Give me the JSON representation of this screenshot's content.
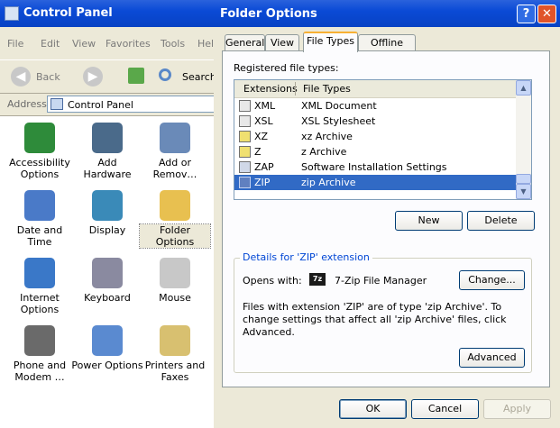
{
  "control_panel": {
    "title": "Control Panel",
    "menu": [
      "File",
      "Edit",
      "View",
      "Favorites",
      "Tools",
      "Hel"
    ],
    "toolbar": {
      "back_label": "Back",
      "search_label": "Search"
    },
    "address": {
      "label": "Address",
      "value": "Control Panel"
    },
    "items": [
      {
        "label": "Accessibility Options",
        "icon": "accessibility-icon",
        "color": "#2e8b3a"
      },
      {
        "label": "Add Hardware",
        "icon": "hardware-icon",
        "color": "#4a6a8a"
      },
      {
        "label": "Add or Remov…",
        "icon": "add-remove-programs-icon",
        "color": "#6a8ab8"
      },
      {
        "label": "Date and Time",
        "icon": "clock-icon",
        "color": "#4a7ac8"
      },
      {
        "label": "Display",
        "icon": "monitor-icon",
        "color": "#3a8ab8"
      },
      {
        "label": "Folder Options",
        "icon": "folder-icon",
        "color": "#e8c050"
      },
      {
        "label": "Internet Options",
        "icon": "globe-icon",
        "color": "#3a78c8"
      },
      {
        "label": "Keyboard",
        "icon": "keyboard-icon",
        "color": "#8a8aa0"
      },
      {
        "label": "Mouse",
        "icon": "mouse-icon",
        "color": "#c8c8c8"
      },
      {
        "label": "Phone and Modem …",
        "icon": "phone-icon",
        "color": "#6a6a6a"
      },
      {
        "label": "Power Options",
        "icon": "power-plug-icon",
        "color": "#5a8ad0"
      },
      {
        "label": "Printers and Faxes",
        "icon": "printer-icon",
        "color": "#d8c070"
      }
    ]
  },
  "folder_options": {
    "title": "Folder Options",
    "help_glyph": "?",
    "close_glyph": "✕",
    "tabs": [
      "General",
      "View",
      "File Types",
      "Offline Files"
    ],
    "registered_label": "Registered file types:",
    "columns": {
      "extensions": "Extensions",
      "file_types": "File Types"
    },
    "rows": [
      {
        "ext": "XML",
        "type": "XML Document"
      },
      {
        "ext": "XSL",
        "type": "XSL Stylesheet"
      },
      {
        "ext": "XZ",
        "type": "xz Archive"
      },
      {
        "ext": "Z",
        "type": "z Archive"
      },
      {
        "ext": "ZAP",
        "type": "Software Installation Settings"
      },
      {
        "ext": "ZIP",
        "type": "zip Archive"
      }
    ],
    "selected_row": "ZIP",
    "new_label": "New",
    "delete_label": "Delete",
    "details": {
      "title": "Details for 'ZIP' extension",
      "opens_with_label": "Opens with:",
      "app_icon_text": "7z",
      "opens_with_value": "7-Zip File Manager",
      "change_label": "Change...",
      "description": "Files with extension 'ZIP' are of type 'zip Archive'.  To change settings that affect all 'zip Archive' files, click Advanced.",
      "advanced_label": "Advanced"
    },
    "ok_label": "OK",
    "cancel_label": "Cancel",
    "apply_label": "Apply"
  }
}
